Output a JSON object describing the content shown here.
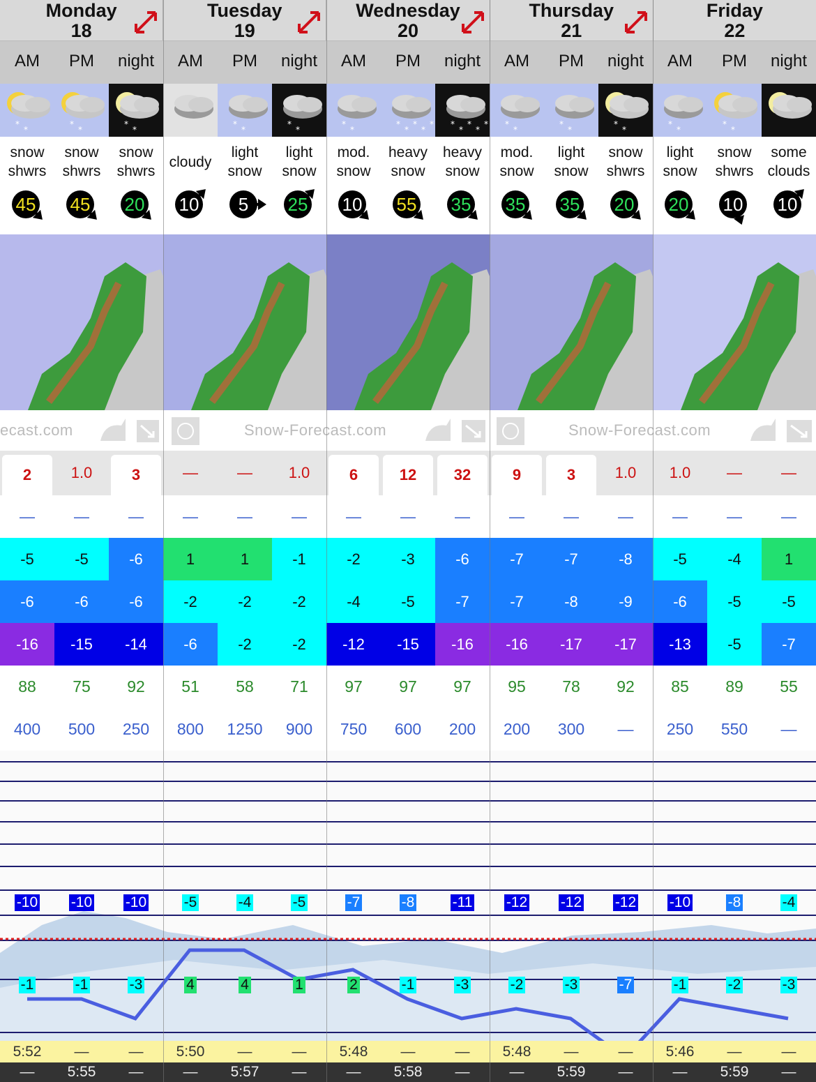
{
  "days": [
    {
      "name": "Monday",
      "date": "18"
    },
    {
      "name": "Tuesday",
      "date": "19"
    },
    {
      "name": "Wednesday",
      "date": "20"
    },
    {
      "name": "Thursday",
      "date": "21"
    },
    {
      "name": "Friday",
      "date": "22"
    }
  ],
  "periods": [
    "AM",
    "PM",
    "night",
    "AM",
    "PM",
    "night",
    "AM",
    "PM",
    "night",
    "AM",
    "PM",
    "night",
    "AM",
    "PM",
    "night"
  ],
  "icons": [
    "sun-cloud-snow",
    "sun-cloud-snow",
    "moon-cloud-snow",
    "overcast",
    "overcast-snow",
    "overcast-snow-night",
    "overcast-snow",
    "overcast-heavy-snow",
    "overcast-heavy-snow-night",
    "overcast-snow",
    "overcast-snow",
    "moon-cloud-snow",
    "overcast-snow",
    "sun-cloud-snow",
    "moon-cloud"
  ],
  "descriptions": [
    [
      "snow",
      "shwrs"
    ],
    [
      "snow",
      "shwrs"
    ],
    [
      "snow",
      "shwrs"
    ],
    [
      "cloudy"
    ],
    [
      "light",
      "snow"
    ],
    [
      "light",
      "snow"
    ],
    [
      "mod.",
      "snow"
    ],
    [
      "heavy",
      "snow"
    ],
    [
      "heavy",
      "snow"
    ],
    [
      "mod.",
      "snow"
    ],
    [
      "light",
      "snow"
    ],
    [
      "snow",
      "shwrs"
    ],
    [
      "light",
      "snow"
    ],
    [
      "snow",
      "shwrs"
    ],
    [
      "some",
      "clouds"
    ]
  ],
  "wind": [
    {
      "speed": "45",
      "color": "#f0e020",
      "dir": 135
    },
    {
      "speed": "45",
      "color": "#f0e020",
      "dir": 135
    },
    {
      "speed": "20",
      "color": "#2ee05a",
      "dir": 135
    },
    {
      "speed": "10",
      "color": "#ffffff",
      "dir": 45
    },
    {
      "speed": "5",
      "color": "#ffffff",
      "dir": 90
    },
    {
      "speed": "25",
      "color": "#2ee05a",
      "dir": 45
    },
    {
      "speed": "10",
      "color": "#ffffff",
      "dir": 135
    },
    {
      "speed": "55",
      "color": "#f0e020",
      "dir": 135
    },
    {
      "speed": "35",
      "color": "#2ee05a",
      "dir": 135
    },
    {
      "speed": "35",
      "color": "#2ee05a",
      "dir": 135
    },
    {
      "speed": "35",
      "color": "#2ee05a",
      "dir": 135
    },
    {
      "speed": "20",
      "color": "#2ee05a",
      "dir": 135
    },
    {
      "speed": "20",
      "color": "#2ee05a",
      "dir": 135
    },
    {
      "speed": "10",
      "color": "#ffffff",
      "dir": 160
    },
    {
      "speed": "10",
      "color": "#ffffff",
      "dir": 45
    }
  ],
  "watermark": {
    "left": "ecast.com",
    "mid": "Snow-Forecast.com",
    "right": "Snow-Forecast.com"
  },
  "snow": [
    "2",
    "1.0",
    "3",
    "—",
    "—",
    "1.0",
    "6",
    "12",
    "32",
    "9",
    "3",
    "1.0",
    "1.0",
    "—",
    "—"
  ],
  "snow_highlight": [
    true,
    false,
    true,
    false,
    false,
    false,
    true,
    true,
    true,
    true,
    true,
    false,
    false,
    false,
    false
  ],
  "rain": [
    "—",
    "—",
    "—",
    "—",
    "—",
    "—",
    "—",
    "—",
    "—",
    "—",
    "—",
    "—",
    "—",
    "—",
    "—"
  ],
  "temp_max": [
    "-5",
    "-5",
    "-6",
    "1",
    "1",
    "-1",
    "-2",
    "-3",
    "-6",
    "-7",
    "-7",
    "-8",
    "-5",
    "-4",
    "1"
  ],
  "temp_min": [
    "-6",
    "-6",
    "-6",
    "-2",
    "-2",
    "-2",
    "-4",
    "-5",
    "-7",
    "-7",
    "-8",
    "-9",
    "-6",
    "-5",
    "-5"
  ],
  "temp_chill": [
    "-16",
    "-15",
    "-14",
    "-6",
    "-2",
    "-2",
    "-12",
    "-15",
    "-16",
    "-16",
    "-17",
    "-17",
    "-13",
    "-5",
    "-7"
  ],
  "humidity": [
    "88",
    "75",
    "92",
    "51",
    "58",
    "71",
    "97",
    "97",
    "97",
    "95",
    "78",
    "92",
    "85",
    "89",
    "55"
  ],
  "freezing_level": [
    "400",
    "500",
    "250",
    "800",
    "1250",
    "900",
    "750",
    "600",
    "200",
    "200",
    "300",
    "—",
    "250",
    "550",
    "—"
  ],
  "upper_temps": [
    "-10",
    "-10",
    "-10",
    "-5",
    "-4",
    "-5",
    "-7",
    "-8",
    "-11",
    "-12",
    "-12",
    "-12",
    "-10",
    "-8",
    "-4"
  ],
  "lower_temps": [
    "-1",
    "-1",
    "-3",
    "4",
    "4",
    "1",
    "2",
    "-1",
    "-3",
    "-2",
    "-3",
    "-7",
    "-1",
    "-2",
    "-3"
  ],
  "sunrise": [
    "5:52",
    "—",
    "—",
    "5:50",
    "—",
    "—",
    "5:48",
    "—",
    "—",
    "5:48",
    "—",
    "—",
    "5:46",
    "—",
    "—"
  ],
  "sunset": [
    "—",
    "5:55",
    "—",
    "—",
    "5:57",
    "—",
    "—",
    "5:58",
    "—",
    "—",
    "5:59",
    "—",
    "—",
    "5:59",
    "—"
  ],
  "colors": {
    "cyan": "#00ffff",
    "mid_blue": "#1a7fff",
    "deep_blue": "#0000e6",
    "purple": "#8a2be2",
    "green": "#22e070",
    "snow_red": "#cc1111",
    "line_blue": "#4a5ee0"
  }
}
